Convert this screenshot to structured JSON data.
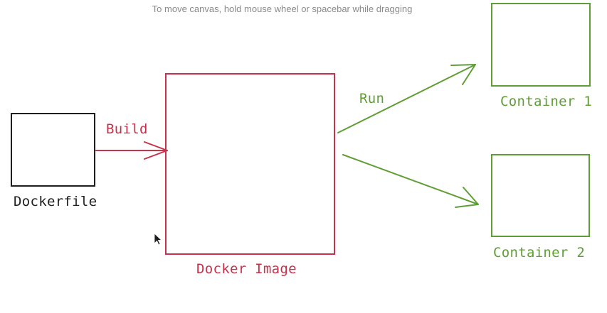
{
  "canvas": {
    "hint": "To move canvas, hold mouse wheel or spacebar while dragging"
  },
  "nodes": {
    "dockerfile": "Dockerfile",
    "docker_image": "Docker Image",
    "container_1": "Container 1",
    "container_2": "Container 2"
  },
  "edges": {
    "build": "Build",
    "run": "Run"
  },
  "colors": {
    "black": "#1e1e1e",
    "red": "#c9304a",
    "green": "#5f9e35"
  },
  "icons": {
    "cursor": "mouse-pointer-icon"
  }
}
